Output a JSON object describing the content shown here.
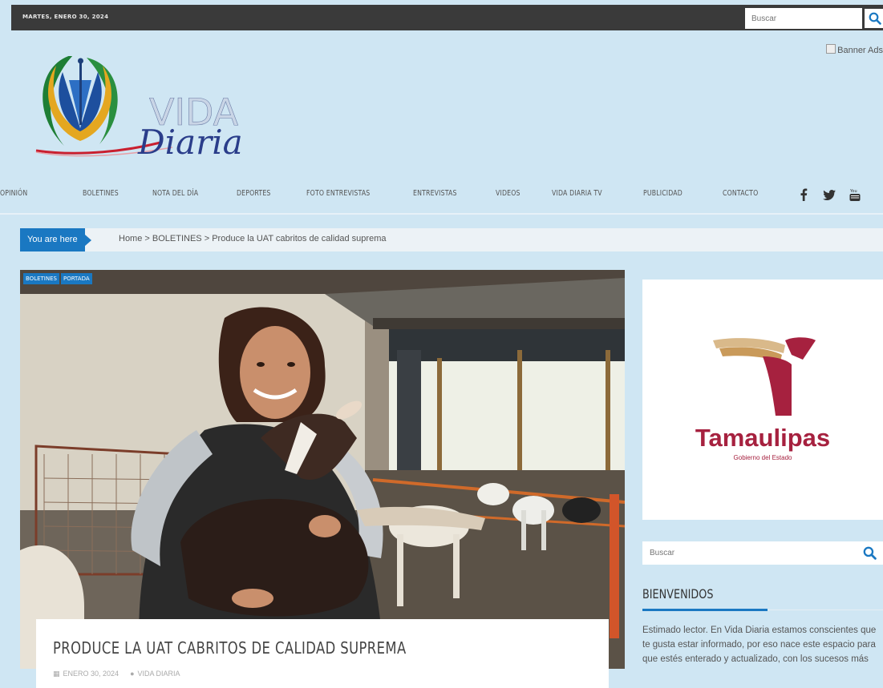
{
  "topbar": {
    "date": "MARTES, ENERO 30, 2024",
    "search_placeholder": "Buscar"
  },
  "header": {
    "logo_word1": "VIDA",
    "logo_word2": "Diaria",
    "banner_alt": "Banner Ads"
  },
  "nav": {
    "items": [
      {
        "label": "OPINIÓN"
      },
      {
        "label": "BOLETINES"
      },
      {
        "label": "NOTA DEL DÍA"
      },
      {
        "label": "DEPORTES"
      },
      {
        "label": "FOTO ENTREVISTAS"
      },
      {
        "label": "ENTREVISTAS"
      },
      {
        "label": "VIDEOS"
      },
      {
        "label": "VIDA DIARIA TV"
      },
      {
        "label": "PUBLICIDAD"
      },
      {
        "label": "CONTACTO"
      }
    ],
    "social": [
      "facebook-icon",
      "twitter-icon",
      "youtube-icon"
    ]
  },
  "breadcrumb": {
    "label": "You are here",
    "home": "Home",
    "sep": ">",
    "category": "BOLETINES",
    "current": "Produce la UAT cabritos de calidad suprema"
  },
  "post": {
    "tags": [
      "BOLETINES",
      "PORTADA"
    ],
    "title": "PRODUCE LA UAT CABRITOS DE CALIDAD SUPREMA",
    "date": "ENERO 30, 2024",
    "author": "VIDA DIARIA"
  },
  "sidebar": {
    "ad_name": "Tamaulipas",
    "ad_sub": "Gobierno del Estado",
    "search_placeholder": "Buscar",
    "widget_title": "BIENVENIDOS",
    "widget_text": "Estimado lector. En Vida Diaria estamos conscientes que te gusta estar informado, por eso nace este espacio para que estés enterado y actualizado, con los sucesos más"
  },
  "colors": {
    "accent": "#1a78c2",
    "page_bg": "#cfe6f3",
    "topbar_bg": "#3a3a3a",
    "brand_red": "#a6213f"
  }
}
